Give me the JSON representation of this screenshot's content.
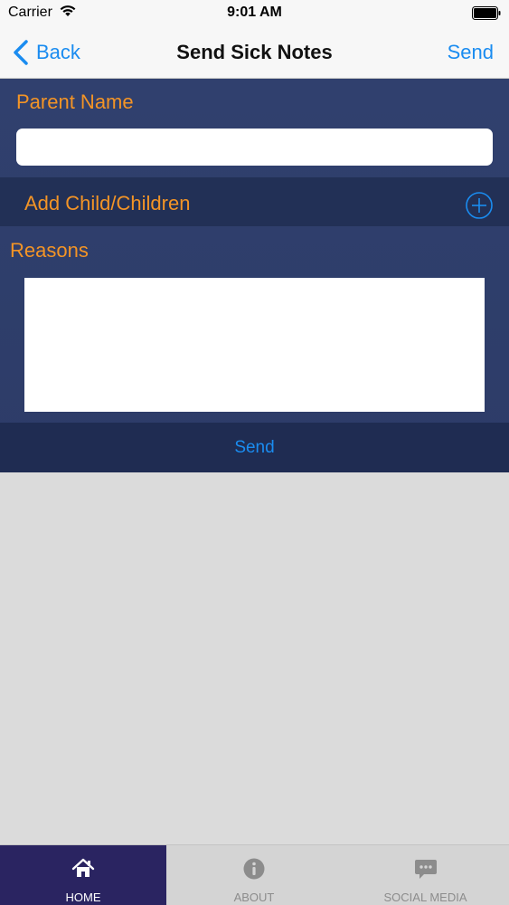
{
  "status_bar": {
    "carrier": "Carrier",
    "time": "9:01 AM"
  },
  "nav": {
    "back_label": "Back",
    "title": "Send Sick Notes",
    "send_label": "Send"
  },
  "form": {
    "parent_name_label": "Parent Name",
    "parent_name_value": "",
    "add_children_label": "Add Child/Children",
    "reasons_label": "Reasons",
    "reasons_value": "",
    "send_button_label": "Send"
  },
  "tabs": [
    {
      "label": "HOME",
      "icon": "home-icon",
      "active": true
    },
    {
      "label": "ABOUT",
      "icon": "info-icon",
      "active": false
    },
    {
      "label": "SOCIAL MEDIA",
      "icon": "chat-bubble-icon",
      "active": false
    }
  ],
  "colors": {
    "accent_blue": "#1a8cf0",
    "label_orange": "#f39426",
    "panel_navy": "#2d3c68",
    "active_tab": "#2a2461"
  }
}
